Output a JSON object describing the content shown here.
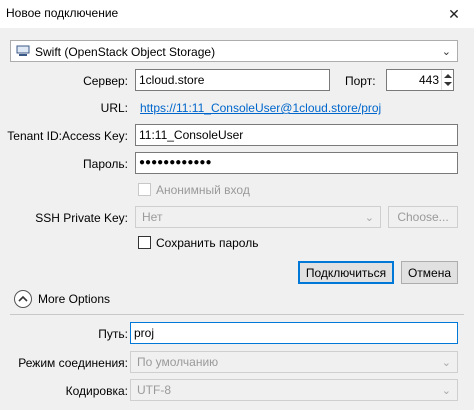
{
  "window": {
    "title": "Новое подключение",
    "close_glyph": "✕"
  },
  "protocol": {
    "value": "Swift (OpenStack Object Storage)",
    "icon": "server-icon"
  },
  "server": {
    "label": "Сервер:",
    "value": "1cloud.store"
  },
  "port": {
    "label": "Порт:",
    "value": "443"
  },
  "url": {
    "label": "URL:",
    "value": "https://11:11_ConsoleUser@1cloud.store/proj"
  },
  "tenant": {
    "label": "Tenant ID:Access Key:",
    "value": "11:11_ConsoleUser"
  },
  "password": {
    "label": "Пароль:",
    "value": "●●●●●●●●●●●●"
  },
  "anonymous": {
    "label": "Анонимный вход",
    "checked": false,
    "disabled": true
  },
  "ssh_key": {
    "label": "SSH Private Key:",
    "value": "Нет",
    "choose_label": "Choose..."
  },
  "save_password": {
    "label": "Сохранить пароль",
    "checked": false
  },
  "buttons": {
    "connect": "Подключиться",
    "cancel": "Отмена"
  },
  "more_options": {
    "label": "More Options",
    "expanded": true
  },
  "path": {
    "label": "Путь:",
    "value": "proj"
  },
  "connect_mode": {
    "label": "Режим соединения:",
    "value": "По умолчанию"
  },
  "encoding": {
    "label": "Кодировка:",
    "value": "UTF-8"
  },
  "colors": {
    "accent": "#0078d7",
    "link": "#0066cc"
  }
}
